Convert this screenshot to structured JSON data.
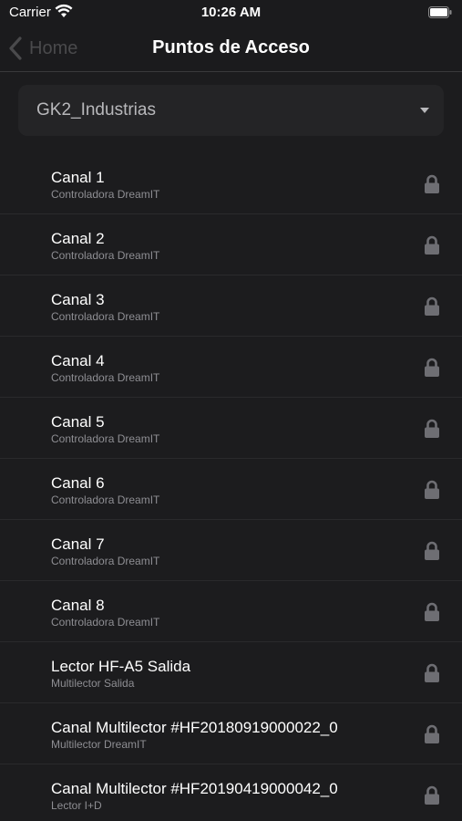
{
  "status_bar": {
    "carrier": "Carrier",
    "time": "10:26 AM"
  },
  "nav": {
    "back_label": "Home",
    "title": "Puntos de Acceso"
  },
  "selector": {
    "value": "GK2_Industrias"
  },
  "access_points": [
    {
      "title": "Canal 1",
      "subtitle": "Controladora DreamIT"
    },
    {
      "title": "Canal 2",
      "subtitle": "Controladora DreamIT"
    },
    {
      "title": "Canal 3",
      "subtitle": "Controladora DreamIT"
    },
    {
      "title": "Canal 4",
      "subtitle": "Controladora DreamIT"
    },
    {
      "title": "Canal 5",
      "subtitle": "Controladora DreamIT"
    },
    {
      "title": "Canal 6",
      "subtitle": "Controladora DreamIT"
    },
    {
      "title": "Canal 7",
      "subtitle": "Controladora DreamIT"
    },
    {
      "title": "Canal 8",
      "subtitle": "Controladora DreamIT"
    },
    {
      "title": "Lector HF-A5 Salida",
      "subtitle": "Multilector Salida"
    },
    {
      "title": "Canal Multilector #HF20180919000022_0",
      "subtitle": "Multilector DreamIT"
    },
    {
      "title": "Canal Multilector #HF20190419000042_0",
      "subtitle": "Lector I+D"
    }
  ],
  "colors": {
    "background": "#1c1c1e",
    "lock_icon": "#6e6e73",
    "subtitle": "#8e8e93"
  },
  "icons": {
    "row_status": "lock-icon",
    "back": "chevron-left-icon",
    "dropdown": "caret-down-icon"
  }
}
